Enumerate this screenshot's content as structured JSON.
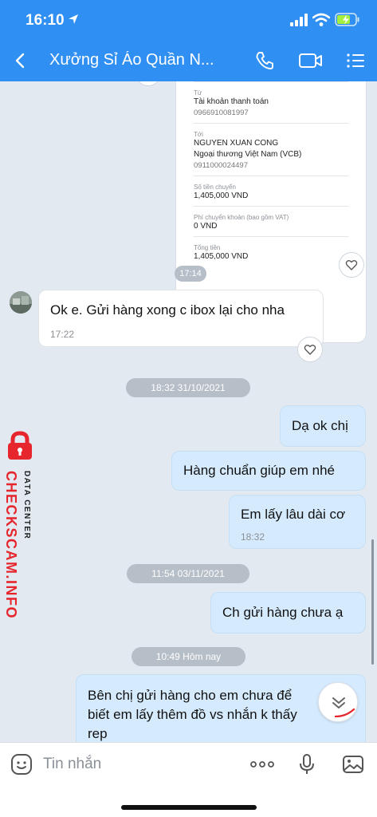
{
  "status_bar": {
    "time": "16:10"
  },
  "header": {
    "title": "Xưởng Sỉ Áo Quần N..."
  },
  "transfer_card": {
    "from_label": "Từ",
    "from_account": "Tài khoản thanh toán",
    "from_number": "0966910081997",
    "to_label": "Tới",
    "to_name": "NGUYEN XUAN CONG",
    "to_bank": "Ngoại thương Việt Nam (VCB)",
    "to_number": "0911000024497",
    "amount_label": "Số tiền chuyển",
    "amount": "1,405,000 VND",
    "fee_label": "Phí chuyển khoản (bao gồm VAT)",
    "fee": "0 VND",
    "total_label": "Tổng tiền",
    "total": "1,405,000 VND",
    "time": "17:14"
  },
  "messages": [
    {
      "text": "Ok e. Gửi hàng xong c ibox lại cho nha",
      "time": "17:22"
    },
    {
      "text": "Dạ ok chị"
    },
    {
      "text": "Hàng chuẩn giúp em nhé"
    },
    {
      "text": "Em lấy lâu dài cơ",
      "time": "18:32"
    },
    {
      "text": "Ch gửi hàng chưa ạ"
    },
    {
      "line1": "Bên chị gửi hàng cho em chưa để",
      "line2": "biết em lấy thêm đồ vs nhắn k thấy",
      "line3": "rep"
    }
  ],
  "separators": {
    "s1": "18:32 31/10/2021",
    "s2": "11:54 03/11/2021",
    "s3": "10:49 Hôm nay"
  },
  "watermark": {
    "brand": "CHECKSCAM.INFO",
    "sub": "DATA CENTER"
  },
  "input": {
    "placeholder": "Tin nhắn"
  },
  "colors": {
    "header": "#2f8ff3",
    "chat_bg": "#e2e9f1",
    "outgoing_bubble": "#d5ebfd",
    "incoming_bubble": "#ffffff",
    "watermark": "#e6252c"
  },
  "icons": [
    "back-arrow-icon",
    "phone-icon",
    "video-icon",
    "menu-list-icon",
    "heart-icon",
    "sticker-icon",
    "more-icon",
    "microphone-icon",
    "image-icon",
    "chevron-double-down-icon"
  ]
}
